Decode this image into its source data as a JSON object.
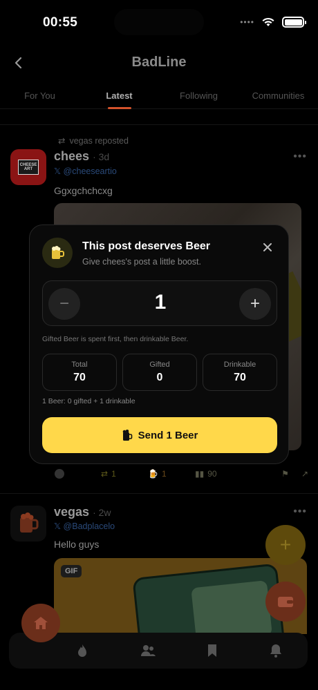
{
  "status_bar": {
    "time": "00:55"
  },
  "header": {
    "title": "BadLine"
  },
  "tabs": [
    {
      "label": "For You",
      "active": false
    },
    {
      "label": "Latest",
      "active": true
    },
    {
      "label": "Following",
      "active": false
    },
    {
      "label": "Communities",
      "active": false
    }
  ],
  "posts": [
    {
      "reposted_by": "vegas reposted",
      "author": "chees",
      "age": "· 3d",
      "handle": "@cheeseartio",
      "text": "Ggxgchchcxg",
      "avatar_text": "CHEESE ART",
      "actions": {
        "reposts": "1",
        "beers": "1",
        "views": "90"
      }
    },
    {
      "author": "vegas",
      "age": "· 2w",
      "handle": "@Badplacelo",
      "text": "Hello guys",
      "media_badge": "GIF"
    }
  ],
  "modal": {
    "title": "This post deserves Beer",
    "subtitle": "Give chees's post a little boost.",
    "quantity": "1",
    "note": "Gifted Beer is spent first, then drinkable Beer.",
    "stats": [
      {
        "label": "Total",
        "value": "70"
      },
      {
        "label": "Gifted",
        "value": "0"
      },
      {
        "label": "Drinkable",
        "value": "70"
      }
    ],
    "breakdown": "1 Beer: 0 gifted + 1 drinkable",
    "send_label": "Send 1 Beer"
  },
  "colors": {
    "accent": "#ffd84a",
    "tab_indicator": "#d4532b",
    "fab_orange": "#6b2e1a"
  }
}
